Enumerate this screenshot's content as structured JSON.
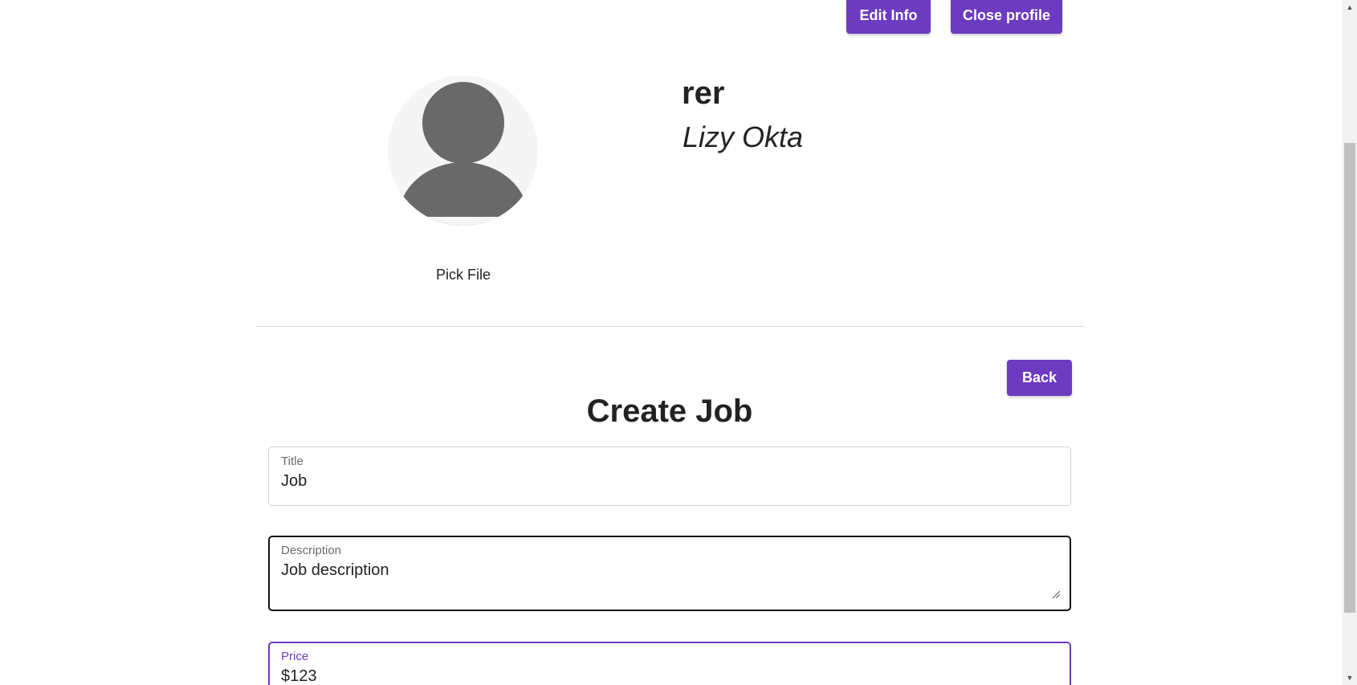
{
  "header": {
    "edit_info_label": "Edit Info",
    "close_profile_label": "Close profile"
  },
  "profile": {
    "username": "rer",
    "full_name": "Lizy Okta",
    "pick_file_label": "Pick File",
    "avatar_icon": "default-user-avatar"
  },
  "form": {
    "back_label": "Back",
    "title": "Create Job",
    "fields": {
      "title": {
        "label": "Title",
        "value": "Job"
      },
      "description": {
        "label": "Description",
        "value": "Job description"
      },
      "price": {
        "label": "Price",
        "value": "$123"
      }
    }
  },
  "colors": {
    "accent": "#6c3bbf",
    "text": "#222222",
    "avatar_fill": "#696969",
    "avatar_bg": "#f5f5f5"
  }
}
